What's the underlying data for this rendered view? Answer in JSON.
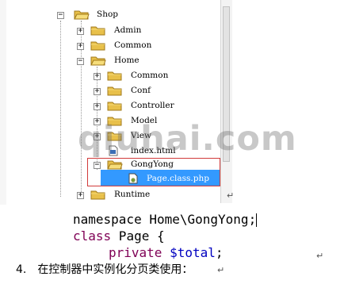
{
  "tree": {
    "nodes": [
      {
        "label": "Shop",
        "toggle": "−"
      },
      {
        "label": "Admin",
        "toggle": "+"
      },
      {
        "label": "Common",
        "toggle": "+"
      },
      {
        "label": "Home",
        "toggle": "−"
      },
      {
        "label": "Common",
        "toggle": "+"
      },
      {
        "label": "Conf",
        "toggle": "+"
      },
      {
        "label": "Controller",
        "toggle": "+"
      },
      {
        "label": "Model",
        "toggle": "+"
      },
      {
        "label": "View",
        "toggle": "+"
      },
      {
        "label": "index.html",
        "toggle": ""
      },
      {
        "label": "GongYong",
        "toggle": "−"
      },
      {
        "label": "Page.class.php",
        "toggle": ""
      },
      {
        "label": "Runtime",
        "toggle": "+"
      }
    ],
    "selected_label": "Page.class.php",
    "colors": {
      "selection": "#3399ff",
      "highlight_border": "#d13a3a",
      "folder": "#e8c04a"
    }
  },
  "watermark": "qiuhai.com",
  "code": {
    "line1_kw": "namespace",
    "line1_rest": " Home\\GongYong;",
    "line2_kw": "class",
    "line2_name": " Page ",
    "line2_brace": "{",
    "line3_kw": "private",
    "line3_var": " $total",
    "line3_end": ";",
    "colors": {
      "keyword": "#7f0055",
      "variable": "#0000c0",
      "text": "#000000"
    }
  },
  "return_mark": "↵",
  "step": {
    "number": "4.",
    "text": "在控制器中实例化分页类使用："
  }
}
